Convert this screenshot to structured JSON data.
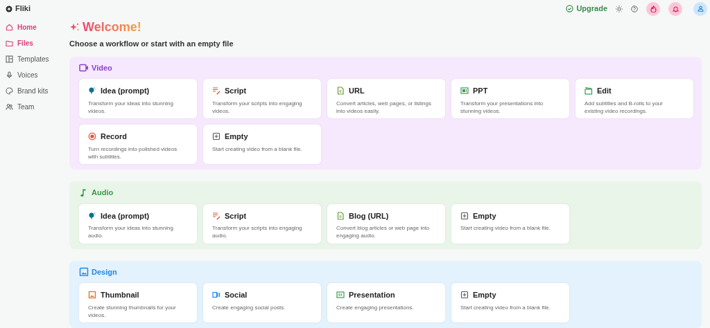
{
  "brand": "Fliki",
  "topbar": {
    "upgrade": "Upgrade"
  },
  "sidebar": {
    "items": [
      {
        "label": "Home",
        "kind": "home",
        "selected": true
      },
      {
        "label": "Files",
        "kind": "folder",
        "selected": true
      },
      {
        "label": "Templates",
        "kind": "templates",
        "selected": false
      },
      {
        "label": "Voices",
        "kind": "mic",
        "selected": false
      },
      {
        "label": "Brand kits",
        "kind": "palette",
        "selected": false
      },
      {
        "label": "Team",
        "kind": "team",
        "selected": false
      }
    ]
  },
  "heading": "Welcome!",
  "subheading": "Choose a workflow or start with an empty file",
  "sections": [
    {
      "title": "Video",
      "kind": "video",
      "cards": [
        {
          "title": "Idea (prompt)",
          "kind": "idea",
          "description": "Transform your ideas into stunning videos."
        },
        {
          "title": "Script",
          "kind": "script",
          "description": "Transform your scripts into engaging videos."
        },
        {
          "title": "URL",
          "kind": "doc",
          "description": "Convert articles, web pages, or listings into videos easily."
        },
        {
          "title": "PPT",
          "kind": "ppt",
          "description": "Transform your presentations into stunning videos."
        },
        {
          "title": "Edit",
          "kind": "edit",
          "description": "Add subtitles and B-rolls to your existing video recordings."
        },
        {
          "title": "Record",
          "kind": "record",
          "description": "Turn recordings into polished videos with subtitles."
        },
        {
          "title": "Empty",
          "kind": "empty",
          "description": "Start creating video from a blank file."
        }
      ]
    },
    {
      "title": "Audio",
      "kind": "audio",
      "cards": [
        {
          "title": "Idea (prompt)",
          "kind": "idea",
          "description": "Transform your ideas into stunning audio."
        },
        {
          "title": "Script",
          "kind": "script",
          "description": "Transform your scripts into engaging audio."
        },
        {
          "title": "Blog (URL)",
          "kind": "doc",
          "description": "Convert blog articles or web page into engaging audio."
        },
        {
          "title": "Empty",
          "kind": "empty",
          "description": "Start creating video from a blank file."
        }
      ]
    },
    {
      "title": "Design",
      "kind": "design",
      "cards": [
        {
          "title": "Thumbnail",
          "kind": "thumbnail",
          "description": "Create stunning thumbnails for your videos."
        },
        {
          "title": "Social",
          "kind": "social",
          "description": "Create engaging social posts."
        },
        {
          "title": "Presentation",
          "kind": "presentation",
          "description": "Create engaging presentations."
        },
        {
          "title": "Empty",
          "kind": "empty",
          "description": "Start creating video from a blank file."
        }
      ]
    }
  ]
}
